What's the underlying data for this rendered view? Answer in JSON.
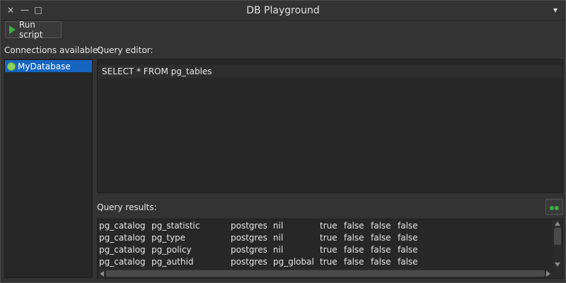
{
  "window": {
    "title": "DB Playground",
    "controls": {
      "close": "×",
      "minimize": "—",
      "maximize": "□",
      "menu": "▾"
    }
  },
  "toolbar": {
    "run_label": "Run script"
  },
  "connections": {
    "label": "Connections available:",
    "items": [
      {
        "label": "MyDatabase",
        "selected": true,
        "status_color": "#8bd35a"
      }
    ]
  },
  "editor": {
    "label": "Query editor:",
    "query": "SELECT * FROM pg_tables"
  },
  "results": {
    "label": "Query results:",
    "rows": [
      [
        "pg_catalog",
        "pg_statistic",
        "postgres",
        "nil",
        "true",
        "false",
        "false",
        "false"
      ],
      [
        "pg_catalog",
        "pg_type",
        "postgres",
        "nil",
        "true",
        "false",
        "false",
        "false"
      ],
      [
        "pg_catalog",
        "pg_policy",
        "postgres",
        "nil",
        "true",
        "false",
        "false",
        "false"
      ],
      [
        "pg_catalog",
        "pg_authid",
        "postgres",
        "pg_global",
        "true",
        "false",
        "false",
        "false"
      ]
    ]
  },
  "colors": {
    "accent": "#1565c0",
    "run_icon": "#3cb043",
    "background": "#333333"
  },
  "icons": {
    "run": "play-icon",
    "connection": "database-status-icon",
    "inspect": "inspect-icon"
  }
}
